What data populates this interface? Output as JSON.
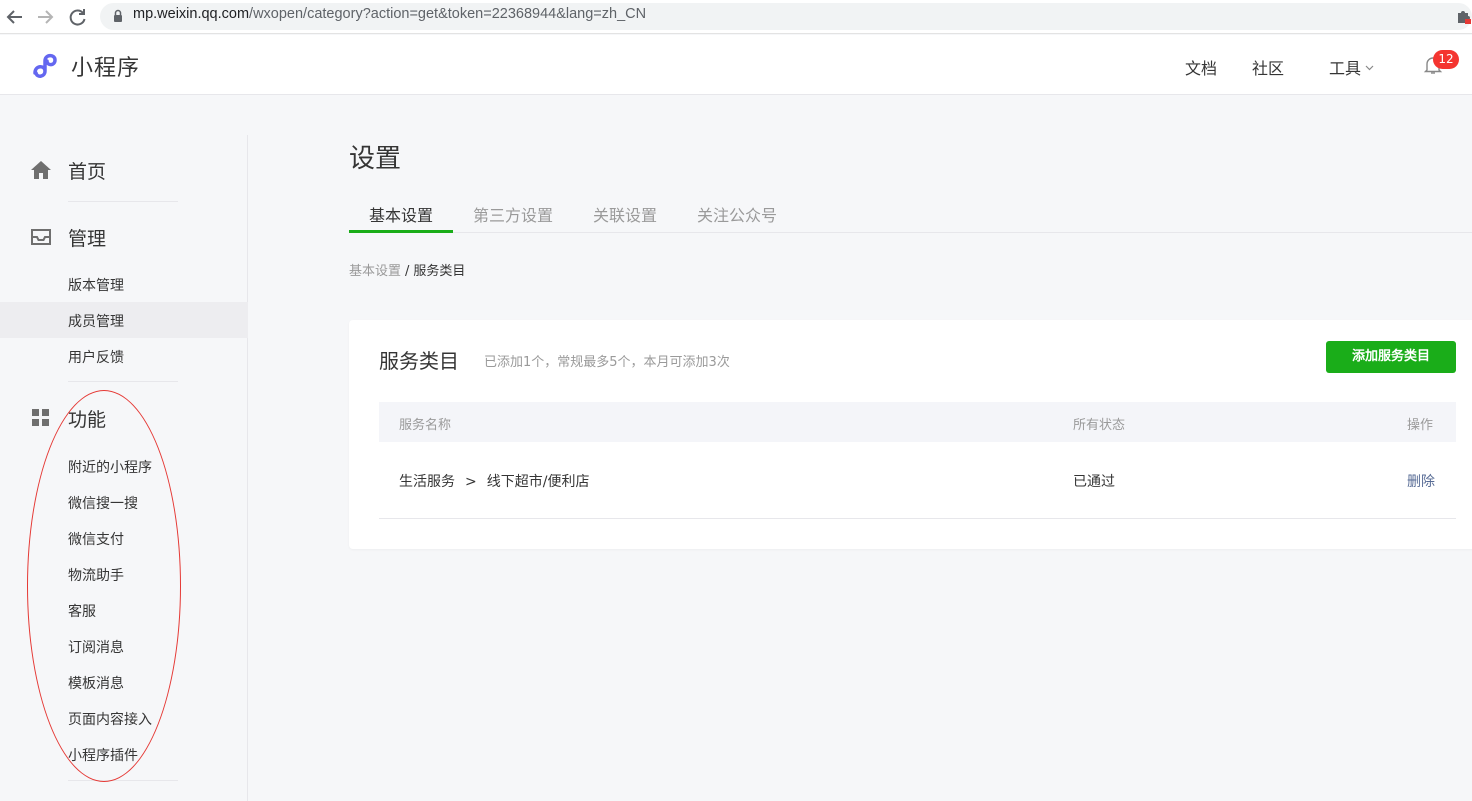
{
  "browser": {
    "url_domain": "mp.weixin.qq.com",
    "url_path": "/wxopen/category?action=get&token=22368944&lang=zh_CN"
  },
  "header": {
    "logo_text": "小程序",
    "links": {
      "docs": "文档",
      "community": "社区",
      "tools": "工具"
    },
    "notification_count": "12"
  },
  "sidebar": {
    "home": "首页",
    "manage": {
      "title": "管理",
      "items": [
        "版本管理",
        "成员管理",
        "用户反馈"
      ]
    },
    "features": {
      "title": "功能",
      "items": [
        "附近的小程序",
        "微信搜一搜",
        "微信支付",
        "物流助手",
        "客服",
        "订阅消息",
        "模板消息",
        "页面内容接入",
        "小程序插件"
      ]
    },
    "active_item": "成员管理"
  },
  "main": {
    "title": "设置",
    "tabs": [
      "基本设置",
      "第三方设置",
      "关联设置",
      "关注公众号"
    ],
    "active_tab": "基本设置",
    "breadcrumb": {
      "parent": "基本设置",
      "separator": "/",
      "current": "服务类目"
    },
    "card": {
      "title": "服务类目",
      "hint": "已添加1个，常规最多5个，本月可添加3次",
      "add_button": "添加服务类目",
      "columns": {
        "name": "服务名称",
        "status": "所有状态",
        "action": "操作"
      },
      "rows": [
        {
          "category": "生活服务",
          "arrow": ">",
          "subcategory": "线下超市/便利店",
          "status": "已通过",
          "action": "删除"
        }
      ]
    }
  },
  "colors": {
    "brand_green": "#1aad19",
    "link_blue": "#576b95",
    "badge_red": "#f43530",
    "annotation_red": "#e53935"
  }
}
